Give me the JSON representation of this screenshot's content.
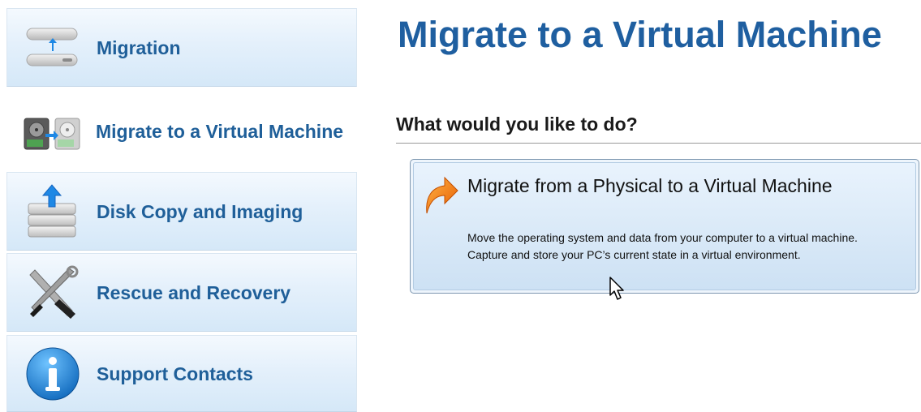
{
  "sidebar": {
    "items": [
      {
        "label": "Migration",
        "icon": "migration-icon",
        "active": false
      },
      {
        "label": "Migrate to a Virtual Machine",
        "icon": "virtual-machine-icon",
        "active": true
      },
      {
        "label": "Disk Copy and Imaging",
        "icon": "disk-copy-icon",
        "active": false
      },
      {
        "label": "Rescue and Recovery",
        "icon": "tools-icon",
        "active": false
      },
      {
        "label": "Support Contacts",
        "icon": "info-icon",
        "active": false
      }
    ]
  },
  "main": {
    "title": "Migrate to a Virtual Machine",
    "question": "What would you like to do?",
    "options": [
      {
        "title": "Migrate from a Physical to a Virtual Machine",
        "description": "Move the operating system and data from your computer to a virtual machine. Capture and store your PC’s current state in a virtual environment.",
        "icon": "orange-arrow-icon"
      }
    ]
  },
  "colors": {
    "accent": "#1f5fa0",
    "nav_label": "#1f5f99",
    "tile_top": "#f4f9fe",
    "tile_bottom": "#d5e8f8",
    "card_border": "#7e97b0"
  }
}
